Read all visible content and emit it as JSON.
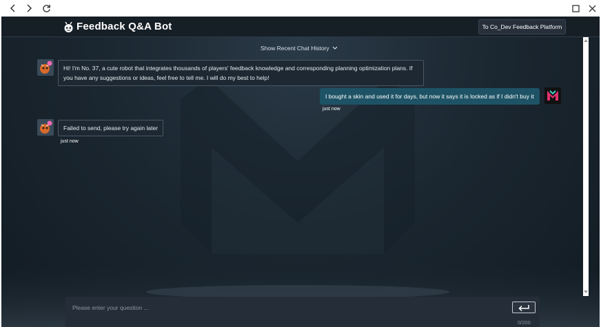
{
  "browser": {
    "back_icon": "chevron-left-icon",
    "forward_icon": "chevron-right-icon",
    "refresh_icon": "refresh-icon",
    "maximize_icon": "maximize-icon",
    "close_icon": "close-icon"
  },
  "header": {
    "title": "Feedback Q&A Bot",
    "logo_icon": "robot-icon",
    "platform_button": "To Co_Dev Feedback Platform"
  },
  "chat": {
    "history_link": "Show Recent Chat History",
    "messages": [
      {
        "role": "bot",
        "text_line1": "Hi! I'm No. 37, a cute robot that integrates thousands of players' feedback knowledge and corresponding planning optimization plans. If",
        "text_line2": "you have any suggestions or ideas, feel free to tell me. I will do my best to help!"
      },
      {
        "role": "user",
        "text": "I bought a skin and used it for days, but now it says it is locked as if I didn't buy it",
        "time": "just now"
      },
      {
        "role": "bot",
        "text": "Failed to send, please try again later",
        "time": "just now"
      }
    ]
  },
  "input": {
    "placeholder": "Please enter your question ...",
    "value": "",
    "send_icon": "enter-icon",
    "char_count": "0/200"
  },
  "colors": {
    "background": "#1b2731",
    "user_bubble": "#1e5366",
    "bot_bubble": "#1d2832",
    "header": "#161e26"
  }
}
